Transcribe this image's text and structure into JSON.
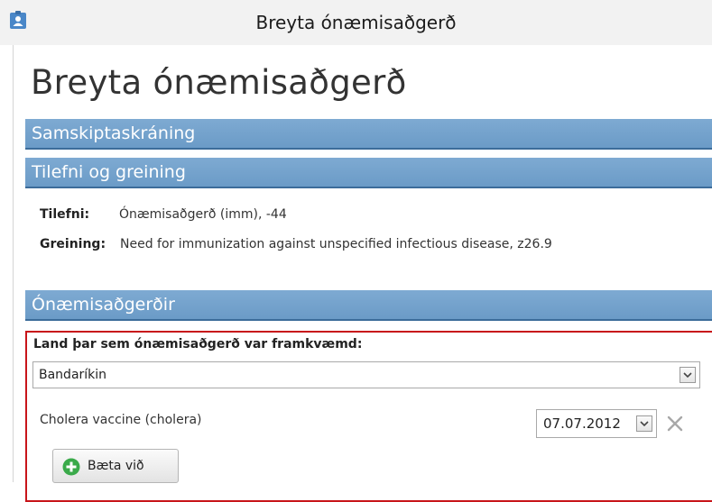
{
  "window": {
    "title": "Breyta ónæmisaðgerð",
    "icon": "contact-card-icon"
  },
  "page": {
    "title": "Breyta ónæmisaðgerð"
  },
  "sections": {
    "communication": "Samskiptaskráning",
    "reason": "Tilefni og greining",
    "immunizations": "Ónæmisaðgerðir"
  },
  "reason": {
    "occasion_label": "Tilefni:",
    "occasion_value": "Ónæmisaðgerð (imm), -44",
    "diagnosis_label": "Greining:",
    "diagnosis_value": "Need for immunization against unspecified infectious disease, z26.9"
  },
  "immunization": {
    "country_label": "Land þar sem ónæmisaðgerð var framkvæmd:",
    "country_value": "Bandaríkin",
    "vaccine_name": "Cholera vaccine (cholera)",
    "date_value": "07.07.2012",
    "add_button_label": "Bæta við"
  },
  "colors": {
    "section_header": "#6b9bc7",
    "highlight_border": "#c8151a",
    "add_icon": "#3aaa4a"
  }
}
